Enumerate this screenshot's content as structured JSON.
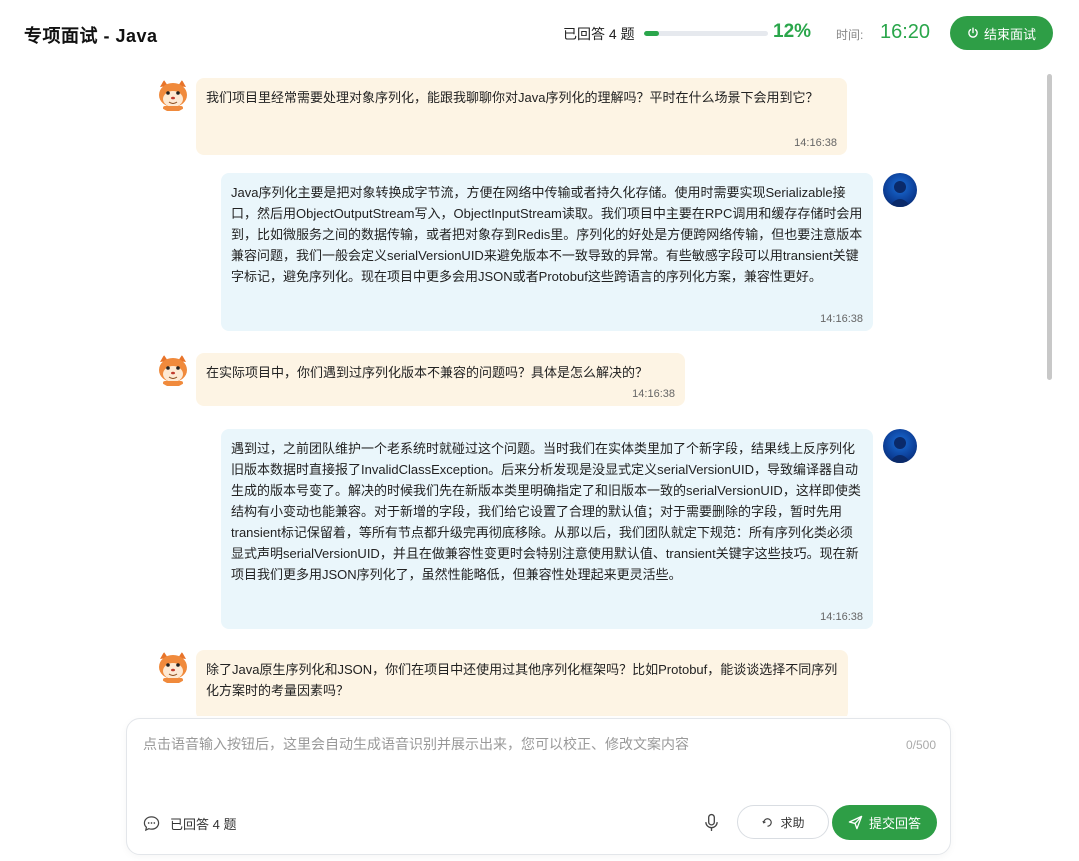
{
  "header": {
    "title": "专项面试 - Java",
    "answered_label": "已回答 4 题",
    "progress_pct": "12%",
    "progress_fraction": 0.12,
    "time_label": "时间:",
    "time_value": "16:20",
    "end_button": "结束面试"
  },
  "colors": {
    "accent": "#2e9e46",
    "ai_bubble": "#fdf4e4",
    "user_bubble": "#eaf6fb"
  },
  "messages": [
    {
      "role": "ai",
      "text": "我们项目里经常需要处理对象序列化，能跟我聊聊你对Java序列化的理解吗？平时在什么场景下会用到它？",
      "time": "14:16:38"
    },
    {
      "role": "user",
      "text": "Java序列化主要是把对象转换成字节流，方便在网络中传输或者持久化存储。使用时需要实现Serializable接口，然后用ObjectOutputStream写入，ObjectInputStream读取。我们项目中主要在RPC调用和缓存存储时会用到，比如微服务之间的数据传输，或者把对象存到Redis里。序列化的好处是方便跨网络传输，但也要注意版本兼容问题，我们一般会定义serialVersionUID来避免版本不一致导致的异常。有些敏感字段可以用transient关键字标记，避免序列化。现在项目中更多会用JSON或者Protobuf这些跨语言的序列化方案，兼容性更好。",
      "time": "14:16:38"
    },
    {
      "role": "ai",
      "text": "在实际项目中，你们遇到过序列化版本不兼容的问题吗？具体是怎么解决的？",
      "time": "14:16:38"
    },
    {
      "role": "user",
      "text": "遇到过，之前团队维护一个老系统时就碰过这个问题。当时我们在实体类里加了个新字段，结果线上反序列化旧版本数据时直接报了InvalidClassException。后来分析发现是没显式定义serialVersionUID，导致编译器自动生成的版本号变了。解决的时候我们先在新版本类里明确指定了和旧版本一致的serialVersionUID，这样即使类结构有小变动也能兼容。对于新增的字段，我们给它设置了合理的默认值；对于需要删除的字段，暂时先用transient标记保留着，等所有节点都升级完再彻底移除。从那以后，我们团队就定下规范：所有序列化类必须显式声明serialVersionUID，并且在做兼容性变更时会特别注意使用默认值、transient关键字这些技巧。现在新项目我们更多用JSON序列化了，虽然性能略低，但兼容性处理起来更灵活些。",
      "time": "14:16:38"
    },
    {
      "role": "ai",
      "text": "除了Java原生序列化和JSON，你们在项目中还使用过其他序列化框架吗？比如Protobuf，能谈谈选择不同序列化方案时的考量因素吗？",
      "time": ""
    }
  ],
  "composer": {
    "placeholder": "点击语音输入按钮后，这里会自动生成语音识别并展示出来，您可以校正、修改文案内容",
    "value": "",
    "counter": "0/500",
    "status": "已回答 4 题",
    "help_button": "求助",
    "submit_button": "提交回答"
  },
  "icons": [
    "power-icon",
    "chat-bubble-icon",
    "microphone-icon",
    "help-icon",
    "send-icon",
    "interviewer-avatar",
    "user-avatar"
  ]
}
